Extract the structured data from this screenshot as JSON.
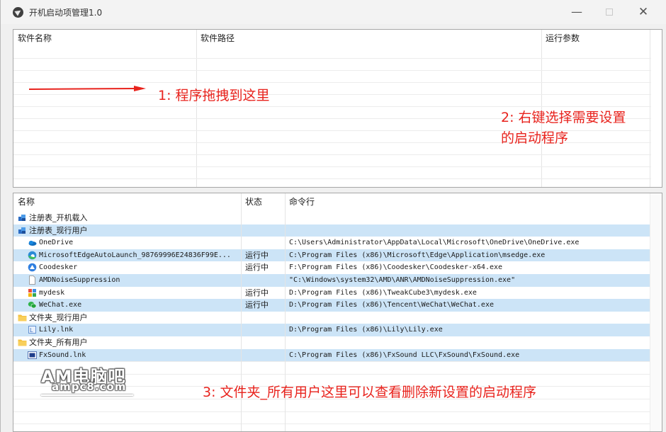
{
  "window": {
    "title": "开机启动项管理1.0",
    "minimize": "—",
    "close": "✕"
  },
  "top_pane": {
    "columns": [
      "软件名称",
      "软件路径",
      "运行参数"
    ],
    "annotation_drag": "1:  程序拖拽到这里",
    "annotation_right_click_line1": "2:  右键选择需要设置",
    "annotation_right_click_line2": "的启动程序"
  },
  "bottom_pane": {
    "columns": [
      "名称",
      "状态",
      "命令行"
    ],
    "rows": [
      {
        "name": "注册表_开机载入",
        "status": "",
        "cmd": "",
        "icon": "registry-icon",
        "indent": 0,
        "selected": false
      },
      {
        "name": "注册表_现行用户",
        "status": "",
        "cmd": "",
        "icon": "registry-icon",
        "indent": 0,
        "selected": true
      },
      {
        "name": "OneDrive",
        "status": "",
        "cmd": "C:\\Users\\Administrator\\AppData\\Local\\Microsoft\\OneDrive\\OneDrive.exe",
        "icon": "onedrive-icon",
        "indent": 1,
        "selected": false
      },
      {
        "name": "MicrosoftEdgeAutoLaunch_98769996E24836F99E...",
        "status": "运行中",
        "cmd": "C:\\Program Files (x86)\\Microsoft\\Edge\\Application\\msedge.exe",
        "icon": "edge-icon",
        "indent": 1,
        "selected": true
      },
      {
        "name": "Coodesker",
        "status": "运行中",
        "cmd": "F:\\Program Files (x86)\\Coodesker\\Coodesker-x64.exe",
        "icon": "coodesker-icon",
        "indent": 1,
        "selected": false
      },
      {
        "name": "AMDNoiseSuppression",
        "status": "",
        "cmd": "\"C:\\Windows\\system32\\AMD\\ANR\\AMDNoiseSuppression.exe\"",
        "icon": "file-icon",
        "indent": 1,
        "selected": true
      },
      {
        "name": "mydesk",
        "status": "运行中",
        "cmd": "D:\\Program Files (x86)\\TweakCube3\\mydesk.exe",
        "icon": "mydesk-icon",
        "indent": 1,
        "selected": false
      },
      {
        "name": "WeChat.exe",
        "status": "运行中",
        "cmd": "D:\\Program Files (x86)\\Tencent\\WeChat\\WeChat.exe",
        "icon": "wechat-icon",
        "indent": 1,
        "selected": true
      },
      {
        "name": "文件夹_现行用户",
        "status": "",
        "cmd": "",
        "icon": "folder-icon",
        "indent": 0,
        "selected": false
      },
      {
        "name": "Lily.lnk",
        "status": "",
        "cmd": "D:\\Program Files (x86)\\Lily\\Lily.exe",
        "icon": "lily-icon",
        "indent": 1,
        "selected": true
      },
      {
        "name": "文件夹_所有用户",
        "status": "",
        "cmd": "",
        "icon": "folder-icon",
        "indent": 0,
        "selected": false
      },
      {
        "name": "FxSound.lnk",
        "status": "",
        "cmd": "C:\\Program Files (x86)\\FxSound LLC\\FxSound\\FxSound.exe",
        "icon": "fxsound-icon",
        "indent": 1,
        "selected": true
      }
    ],
    "annotation_folder": "3:  文件夹_所有用户这里可以查看删除新设置的启动程序"
  },
  "watermark": {
    "line1": "AM电脑吧",
    "line2": "ampc8.com"
  },
  "colors": {
    "annotation": "#e8231d",
    "selected_row": "#cce4f7"
  }
}
